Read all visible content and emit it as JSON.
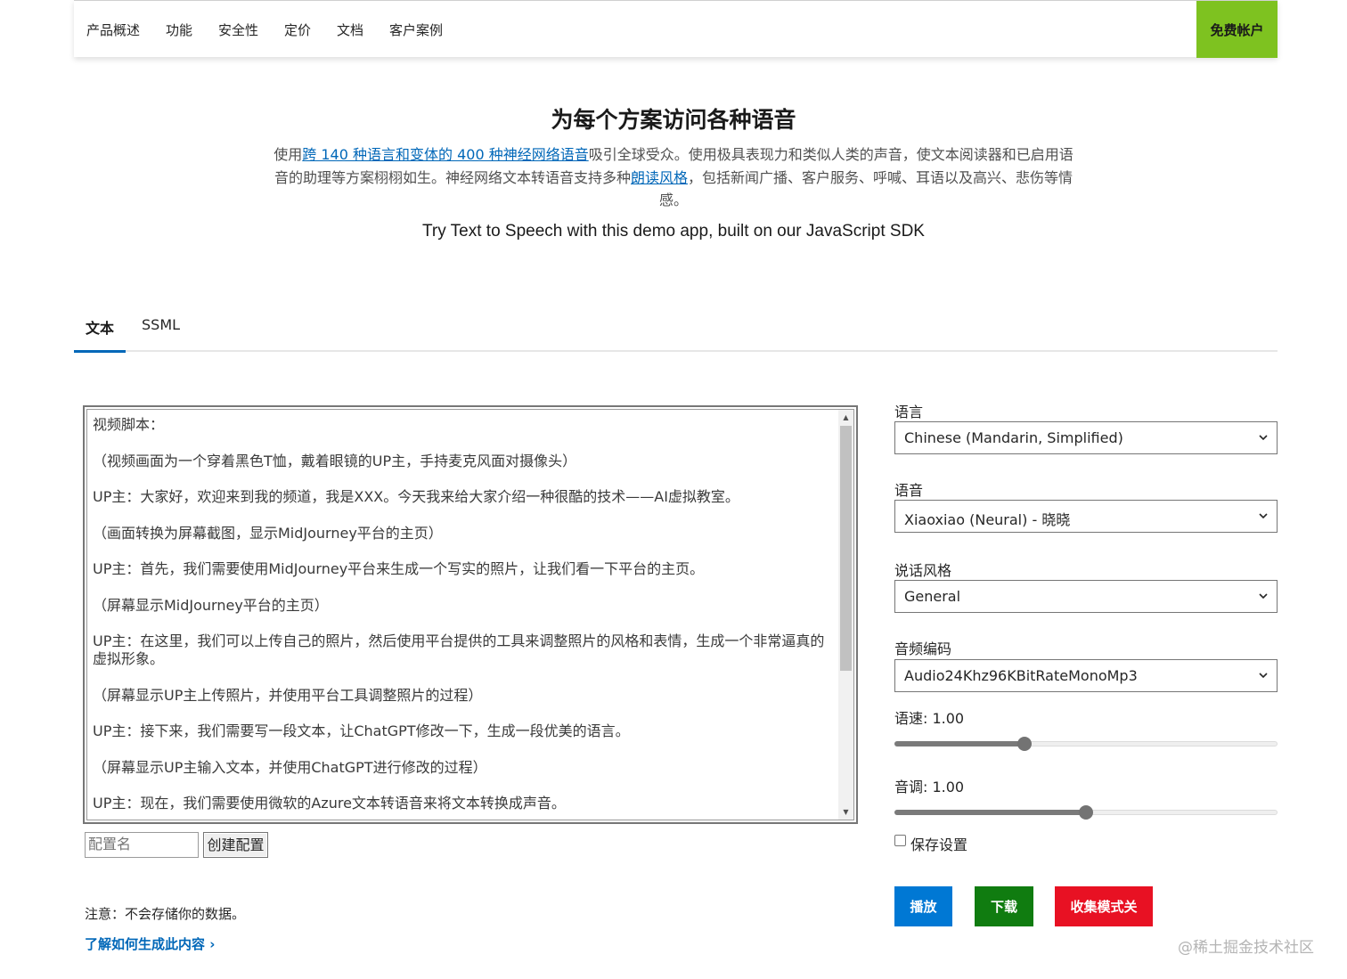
{
  "nav": {
    "items": [
      "产品概述",
      "功能",
      "安全性",
      "定价",
      "文档",
      "客户案例"
    ],
    "cta": "免费帐户"
  },
  "hero": {
    "title": "为每个方案访问各种语音",
    "desc_1": "使用",
    "desc_link1": "跨 140 种语言和变体的 400 种神经网络语音",
    "desc_2": "吸引全球受众。使用极具表现力和类似人类的声音，使文本阅读器和已启用语音的助理等方案栩栩如生。神经网络文本转语音支持多种",
    "desc_link2": "朗读风格",
    "desc_3": "，包括新闻广播、客户服务、呼喊、耳语以及高兴、悲伤等情感。",
    "subtitle": "Try Text to Speech with this demo app, built on our JavaScript SDK"
  },
  "tabs": [
    {
      "label": "文本",
      "active": true
    },
    {
      "label": "SSML",
      "active": false
    }
  ],
  "script": {
    "lines": [
      "视频脚本：",
      "（视频画面为一个穿着黑色T恤，戴着眼镜的UP主，手持麦克风面对摄像头）",
      "UP主：大家好，欢迎来到我的频道，我是XXX。今天我来给大家介绍一种很酷的技术——AI虚拟教室。",
      "（画面转换为屏幕截图，显示MidJourney平台的主页）",
      "UP主：首先，我们需要使用MidJourney平台来生成一个写实的照片，让我们看一下平台的主页。",
      "（屏幕显示MidJourney平台的主页）",
      "UP主：在这里，我们可以上传自己的照片，然后使用平台提供的工具来调整照片的风格和表情，生成一个非常逼真的虚拟形象。",
      "（屏幕显示UP主上传照片，并使用平台工具调整照片的过程）",
      "UP主：接下来，我们需要写一段文本，让ChatGPT修改一下，生成一段优美的语言。",
      "（屏幕显示UP主输入文本，并使用ChatGPT进行修改的过程）",
      "UP主：现在，我们需要使用微软的Azure文本转语音来将文本转换成声音。"
    ]
  },
  "config": {
    "name_placeholder": "配置名",
    "create_label": "创建配置"
  },
  "note": "注意：不会存储你的数据。",
  "learn_link": "了解如何生成此内容 ›",
  "settings": {
    "language_label": "语言",
    "language_value": "Chinese (Mandarin, Simplified)",
    "voice_label": "语音",
    "voice_value": "Xiaoxiao (Neural) - 晓晓",
    "style_label": "说话风格",
    "style_value": "General",
    "format_label": "音频编码",
    "format_value": "Audio24Khz96KBitRateMonoMp3",
    "rate_label": "语速: 1.00",
    "rate_fraction": 0.34,
    "pitch_label": "音调: 1.00",
    "pitch_fraction": 0.5,
    "save_label": "保存设置",
    "save_checked": false
  },
  "buttons": {
    "play": "播放",
    "download": "下载",
    "collect": "收集模式关"
  },
  "colors": {
    "cta": "#7ec220",
    "play": "#0078d4",
    "download": "#107c10",
    "collect": "#e81123",
    "link": "#0067b8"
  },
  "watermark": "@稀土掘金技术社区"
}
